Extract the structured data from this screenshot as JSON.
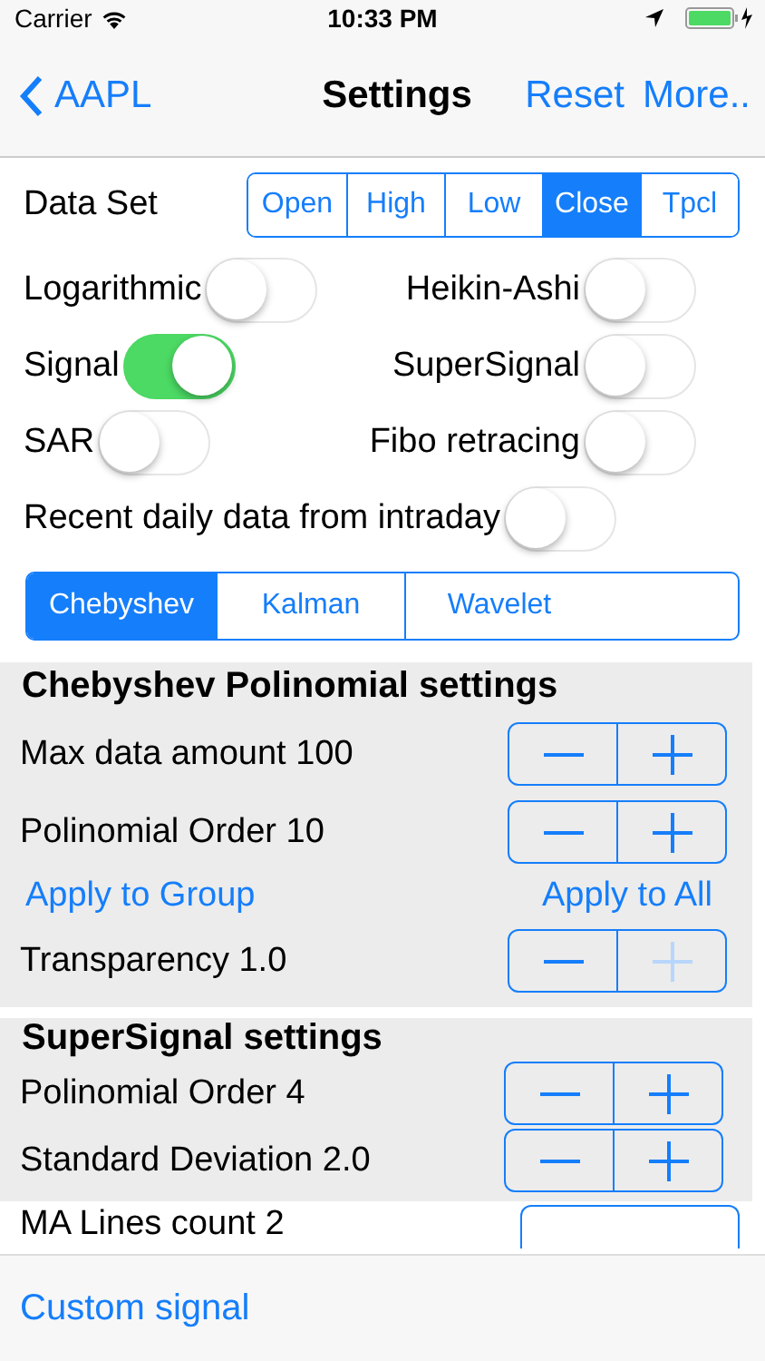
{
  "status_bar": {
    "carrier": "Carrier",
    "time": "10:33 PM"
  },
  "nav": {
    "back": "AAPL",
    "title": "Settings",
    "actions": [
      "Reset",
      "More.."
    ]
  },
  "data_set": {
    "label": "Data Set",
    "options": [
      {
        "label": "Open",
        "selected": false
      },
      {
        "label": "High",
        "selected": false
      },
      {
        "label": "Low",
        "selected": false
      },
      {
        "label": "Close",
        "selected": true
      },
      {
        "label": "Tpcl",
        "selected": false
      }
    ]
  },
  "toggle_rows": [
    [
      {
        "label": "Logarithmic",
        "on": false
      },
      {
        "label": "Heikin-Ashi",
        "on": false
      }
    ],
    [
      {
        "label": "Signal",
        "on": true
      },
      {
        "label": "SuperSignal",
        "on": false
      }
    ],
    [
      {
        "label": "SAR",
        "on": false
      },
      {
        "label": "Fibo retracing",
        "on": false
      }
    ],
    [
      {
        "label": "Recent daily data from intraday",
        "on": false
      }
    ]
  ],
  "methods": [
    {
      "label": "Chebyshev",
      "selected": true
    },
    {
      "label": "Kalman",
      "selected": false
    },
    {
      "label": "Wavelet",
      "selected": false
    }
  ],
  "sections": [
    {
      "title": "Chebyshev Polinomial settings",
      "rows": [
        {
          "kind": "stepper",
          "label": "Max data amount 100",
          "minus_disabled": false,
          "plus_disabled": false
        },
        {
          "kind": "stepper",
          "label": "Polinomial Order  10",
          "minus_disabled": false,
          "plus_disabled": false
        },
        {
          "kind": "links",
          "left": "Apply to Group",
          "right": "Apply to All"
        },
        {
          "kind": "stepper",
          "label": "Transparency 1.0",
          "minus_disabled": false,
          "plus_disabled": true
        }
      ]
    },
    {
      "title": "SuperSignal settings",
      "rows": [
        {
          "kind": "stepper",
          "label": "Polinomial Order   4",
          "minus_disabled": false,
          "plus_disabled": false
        },
        {
          "kind": "stepper",
          "label": "Standard Deviation 2.0",
          "minus_disabled": false,
          "plus_disabled": false
        }
      ]
    }
  ],
  "partial_row": {
    "label": "MA Lines count   2"
  },
  "bottom_bar": {
    "button": "Custom signal"
  }
}
